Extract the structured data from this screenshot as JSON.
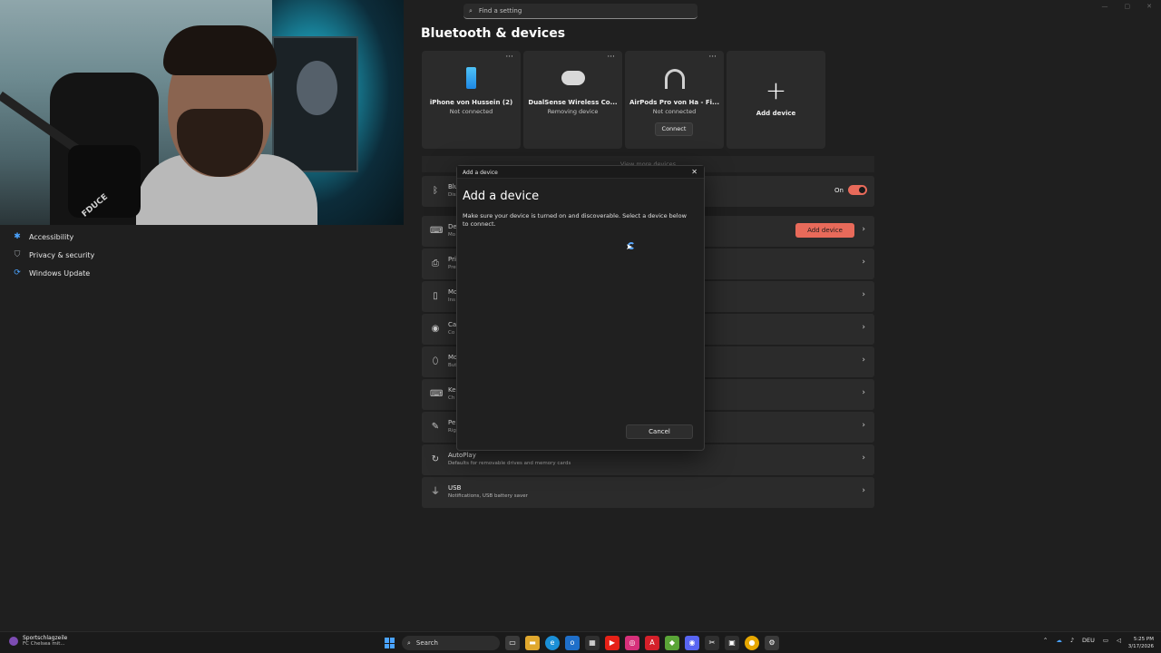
{
  "search": {
    "placeholder": "Find a setting"
  },
  "page_title": "Bluetooth & devices",
  "sidebar": {
    "items": [
      {
        "label": "Accessibility"
      },
      {
        "label": "Privacy & security"
      },
      {
        "label": "Windows Update"
      }
    ]
  },
  "webcam": {
    "mic_label": "FDUCE"
  },
  "devices": [
    {
      "name": "iPhone von Hussein (2)",
      "status": "Not connected",
      "icon": "phone-icon"
    },
    {
      "name": "DualSense Wireless Co...",
      "status": "Removing device",
      "icon": "gamepad-icon"
    },
    {
      "name": "AirPods Pro von Ha - Fi...",
      "status": "Not connected",
      "icon": "headphones-icon",
      "action": "Connect"
    }
  ],
  "add_device_card": {
    "label": "Add device"
  },
  "more_glyph": "···",
  "view_more": "View more devices",
  "rows": [
    {
      "title": "Blu",
      "sub": "Dis",
      "icon": "bluetooth-icon",
      "on_label": "On"
    },
    {
      "title": "De",
      "sub": "Mo",
      "icon": "devices-icon",
      "button": "Add device"
    },
    {
      "title": "Pri",
      "sub": "Pre",
      "icon": "printer-icon"
    },
    {
      "title": "Mo",
      "sub": "Ins",
      "icon": "phone-link-icon"
    },
    {
      "title": "Ca",
      "sub": "Co",
      "icon": "camera-icon"
    },
    {
      "title": "Mo",
      "sub": "But",
      "icon": "mouse-icon"
    },
    {
      "title": "Ke",
      "sub": "Ch",
      "icon": "keyboard-icon"
    },
    {
      "title": "Pe",
      "sub": "Rig",
      "icon": "pen-icon"
    },
    {
      "title": "AutoPlay",
      "sub": "Defaults for removable drives and memory cards",
      "icon": "autoplay-icon"
    },
    {
      "title": "USB",
      "sub": "Notifications, USB battery saver",
      "icon": "usb-icon"
    }
  ],
  "dialog": {
    "window_title": "Add a device",
    "heading": "Add a device",
    "description": "Make sure your device is turned on and discoverable. Select a device below to connect.",
    "cancel_label": "Cancel"
  },
  "taskbar": {
    "news_title": "Sportschlagzeile",
    "news_sub": "FC Chelsea mit...",
    "search_label": "Search",
    "language": "DEU",
    "time": "5:25 PM",
    "date": "3/17/2026"
  },
  "colors": {
    "accent": "#e86a5a",
    "bluetooth_blue": "#4aa3ff"
  }
}
